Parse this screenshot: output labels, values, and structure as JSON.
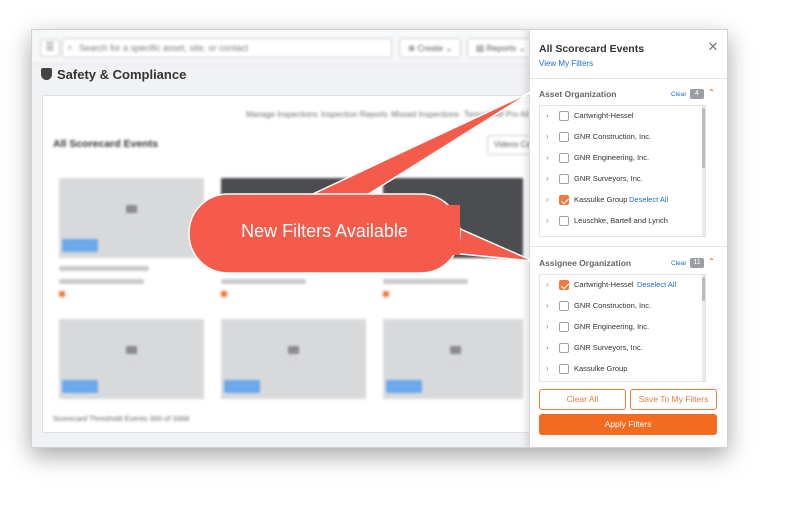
{
  "header": {
    "search_placeholder": "Search for a specific asset, site, or contact",
    "create_label": "Create",
    "reports_label": "Reports"
  },
  "page": {
    "title": "Safety & Compliance",
    "subnav": [
      "Manage Inspections",
      "Inspection Reports",
      "Missed Inspections",
      "TennaCAM Pro",
      "All"
    ],
    "section_title": "All Scorecard Events",
    "videos_button": "Videos Ca",
    "footer_count": "Scorecard Threshold Events 300 of 3368"
  },
  "panel": {
    "title": "All Scorecard Events",
    "view_filters_link": "View My Filters",
    "asset_org": {
      "label": "Asset Organization",
      "clear": "Clear",
      "count": "4",
      "items": [
        {
          "label": "Cartwright-Hessel",
          "checked": false,
          "deselect": ""
        },
        {
          "label": "GNR Construction, Inc.",
          "checked": false,
          "deselect": ""
        },
        {
          "label": "GNR Engineering, Inc.",
          "checked": false,
          "deselect": ""
        },
        {
          "label": "GNR Surveyors, Inc.",
          "checked": false,
          "deselect": ""
        },
        {
          "label": "Kassulke Group",
          "checked": true,
          "deselect": "Deselect All"
        },
        {
          "label": "Leuschke, Bartell and Lynch",
          "checked": false,
          "deselect": ""
        }
      ]
    },
    "assignee_org": {
      "label": "Assignee Organization",
      "clear": "Clear",
      "count": "11",
      "items": [
        {
          "label": "Cartwright-Hessel",
          "checked": true,
          "deselect": "Deselect All"
        },
        {
          "label": "GNR Construction, Inc.",
          "checked": false,
          "deselect": ""
        },
        {
          "label": "GNR Engineering, Inc.",
          "checked": false,
          "deselect": ""
        },
        {
          "label": "GNR Surveyors, Inc.",
          "checked": false,
          "deselect": ""
        },
        {
          "label": "Kassulke Group",
          "checked": false,
          "deselect": ""
        }
      ]
    },
    "clear_all": "Clear All",
    "save_filters": "Save To My Filters",
    "apply_filters": "Apply Filters"
  },
  "callout": {
    "text": "New Filters Available",
    "color": "#f45b4b"
  },
  "colors": {
    "accent": "#f26b21",
    "link": "#1b6fc9"
  }
}
